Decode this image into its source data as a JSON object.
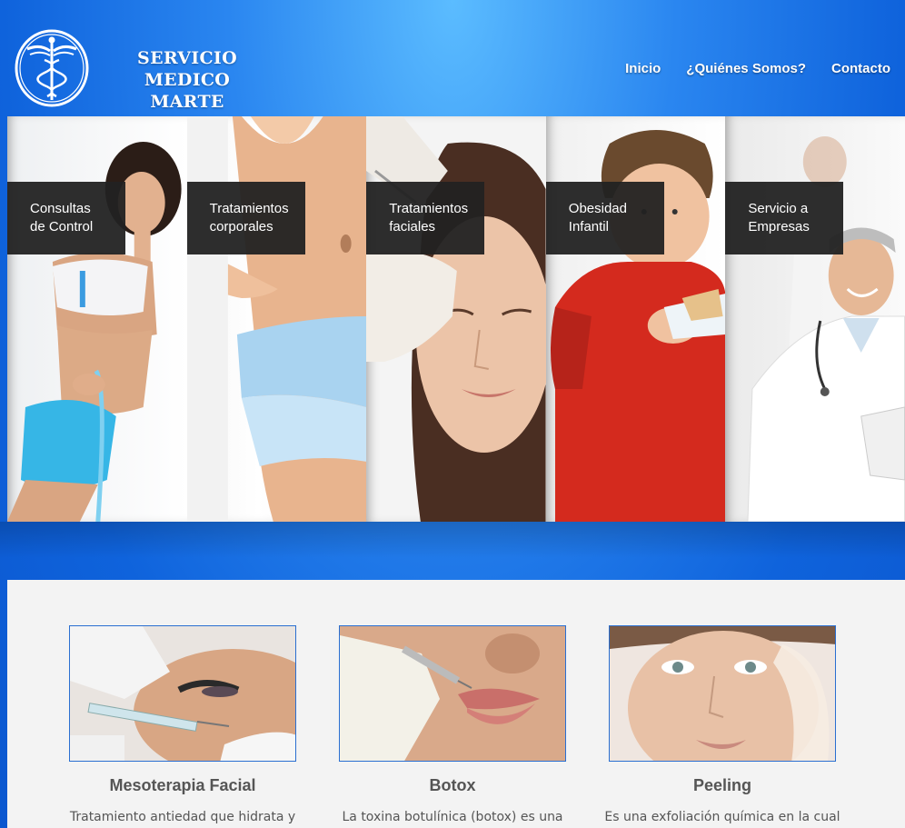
{
  "header": {
    "brand_line1": "SERVICIO MEDICO",
    "brand_line2": "MARTE",
    "nav": [
      "Inicio",
      "¿Quiénes Somos?",
      "Contacto"
    ]
  },
  "panels": [
    {
      "line1": "Consultas",
      "line2": "de Control"
    },
    {
      "line1": "Tratamientos",
      "line2": "corporales"
    },
    {
      "line1": "Tratamientos",
      "line2": "faciales"
    },
    {
      "line1": "Obesidad",
      "line2": "Infantil"
    },
    {
      "line1": "Servicio a",
      "line2": "Empresas"
    }
  ],
  "services": [
    {
      "title": "Mesoterapia Facial",
      "text": "Tratamiento antiedad que hidrata y"
    },
    {
      "title": "Botox",
      "text": "La toxina botulínica (botox) es una"
    },
    {
      "title": "Peeling",
      "text": "Es una exfoliación química en la cual"
    }
  ],
  "colors": {
    "accent": "#0f63dc",
    "panel_label_bg": "#222222",
    "thumb_border": "#2a6fd1"
  }
}
